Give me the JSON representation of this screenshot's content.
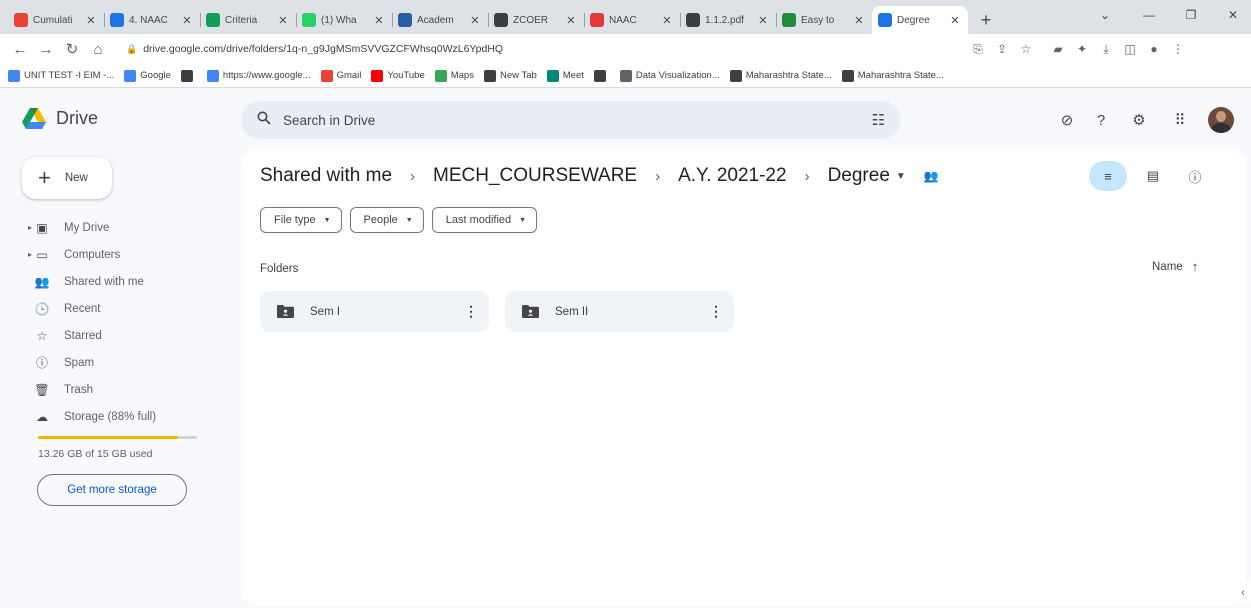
{
  "browser": {
    "tabs": [
      {
        "title": "Cumulati",
        "favicon": "gmail-icon",
        "color": "#ea4335",
        "active": false
      },
      {
        "title": "4. NAAC",
        "favicon": "drive-icon",
        "color": "#1a73e8",
        "active": false
      },
      {
        "title": "Criteria",
        "favicon": "sheets-icon",
        "color": "#0f9d58",
        "active": false
      },
      {
        "title": "(1) Wha",
        "favicon": "whatsapp-icon",
        "color": "#25d366",
        "active": false
      },
      {
        "title": "Academ",
        "favicon": "z-icon",
        "color": "#2a5da8",
        "active": false
      },
      {
        "title": "ZCOER",
        "favicon": "chrome-icon",
        "color": "#3c4043",
        "active": false
      },
      {
        "title": "NAAC",
        "favicon": "naac-icon",
        "color": "#e53935",
        "active": false
      },
      {
        "title": "1.1.2.pdf",
        "favicon": "chrome-icon",
        "color": "#3c4043",
        "active": false
      },
      {
        "title": "Easy to",
        "favicon": "s-icon",
        "color": "#1e8e3e",
        "active": false
      },
      {
        "title": "Degree",
        "favicon": "drive-icon",
        "color": "#1a73e8",
        "active": true
      }
    ],
    "url": "drive.google.com/drive/folders/1q-n_g9JgMSmSVVGZCFWhsq0WzL6YpdHQ",
    "bookmarks": [
      {
        "label": "UNIT TEST -I EIM -...",
        "icon": "google-icon",
        "color": "#4285f4"
      },
      {
        "label": "Google",
        "icon": "google-icon",
        "color": "#4285f4"
      },
      {
        "label": "",
        "icon": "globe-icon",
        "color": "#3c4043"
      },
      {
        "label": "https://www.google...",
        "icon": "google-icon",
        "color": "#4285f4"
      },
      {
        "label": "Gmail",
        "icon": "gmail-icon",
        "color": "#ea4335"
      },
      {
        "label": "YouTube",
        "icon": "youtube-icon",
        "color": "#ff0000"
      },
      {
        "label": "Maps",
        "icon": "maps-icon",
        "color": "#34a853"
      },
      {
        "label": "New Tab",
        "icon": "globe-icon",
        "color": "#3c4043"
      },
      {
        "label": "Meet",
        "icon": "meet-icon",
        "color": "#00897b"
      },
      {
        "label": "",
        "icon": "globe-icon",
        "color": "#3c4043"
      },
      {
        "label": "Data Visualization...",
        "icon": "dv-icon",
        "color": "#5f6368"
      },
      {
        "label": "Maharashtra State...",
        "icon": "emblem-icon",
        "color": "#3c4043"
      },
      {
        "label": "Maharashtra State...",
        "icon": "emblem-icon",
        "color": "#3c4043"
      }
    ]
  },
  "drive": {
    "app_name": "Drive",
    "search_placeholder": "Search in Drive",
    "new_label": "New",
    "nav": [
      {
        "label": "My Drive",
        "icon": "my-drive-icon",
        "glyph": "▣",
        "caret": true
      },
      {
        "label": "Computers",
        "icon": "computer-icon",
        "glyph": "▭",
        "caret": true
      },
      {
        "label": "Shared with me",
        "icon": "shared-icon",
        "glyph": "👥",
        "caret": false
      },
      {
        "label": "Recent",
        "icon": "clock-icon",
        "glyph": "🕓",
        "caret": false
      },
      {
        "label": "Starred",
        "icon": "star-icon",
        "glyph": "☆",
        "caret": false
      },
      {
        "label": "Spam",
        "icon": "spam-icon",
        "glyph": "ⓘ",
        "caret": false
      },
      {
        "label": "Trash",
        "icon": "trash-icon",
        "glyph": "🗑",
        "caret": false
      },
      {
        "label": "Storage (88% full)",
        "icon": "cloud-icon",
        "glyph": "☁",
        "caret": false
      }
    ],
    "storage": {
      "used_text": "13.26 GB of 15 GB used",
      "fraction": 0.88,
      "bar_color": "#f4b400"
    },
    "get_more_storage": "Get more storage",
    "breadcrumb": [
      "Shared with me",
      "MECH_COURSEWARE",
      "A.Y. 2021-22",
      "Degree"
    ],
    "filters": [
      "File type",
      "People",
      "Last modified"
    ],
    "section_title": "Folders",
    "sort_label": "Name",
    "folders": [
      {
        "name": "Sem I"
      },
      {
        "name": "Sem II"
      }
    ]
  }
}
